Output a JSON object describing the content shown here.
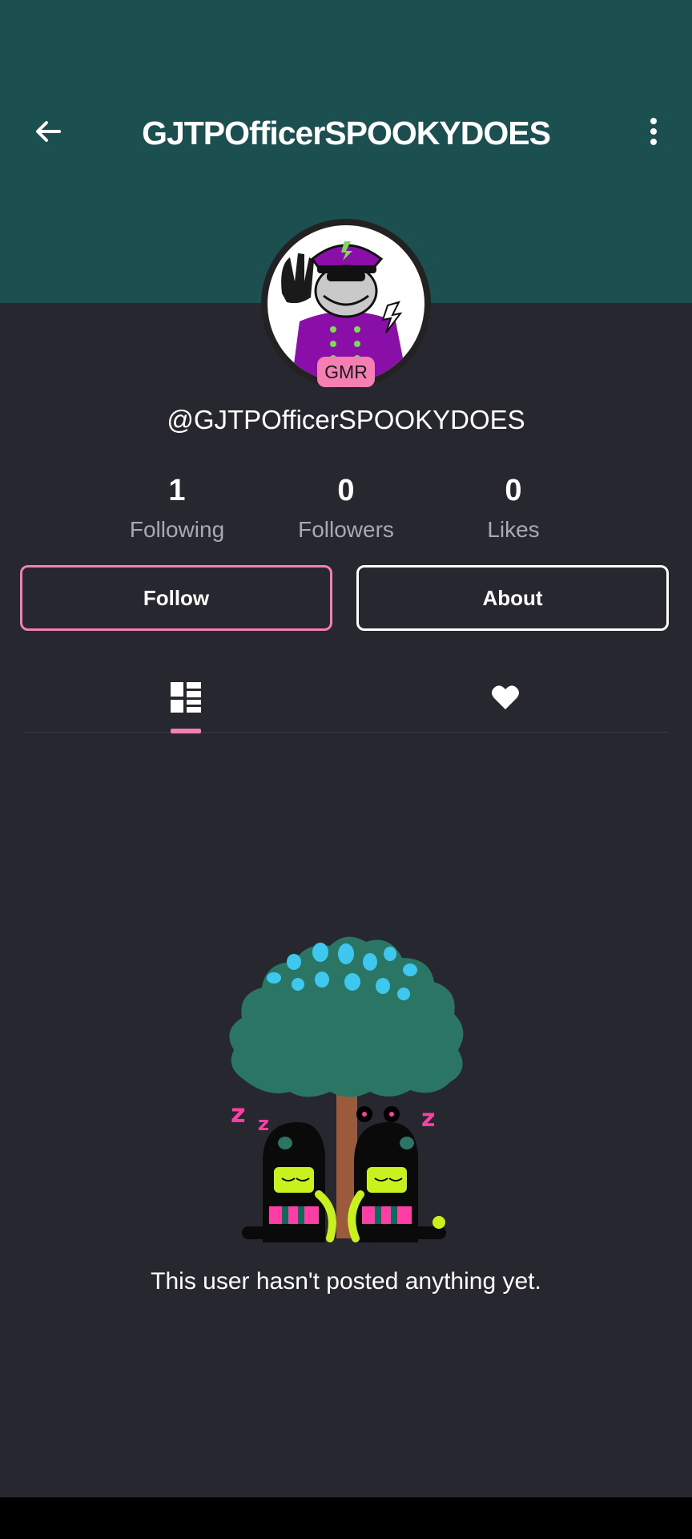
{
  "header": {
    "title": "GJTPOfficerSPOOKYDOES",
    "background_color": "#1c4f50",
    "back_icon": "arrow-left-icon",
    "menu_icon": "more-vertical-icon"
  },
  "profile": {
    "avatar_icon": "officer-avatar",
    "badge": "GMR",
    "username": "@GJTPOfficerSPOOKYDOES"
  },
  "stats": [
    {
      "value": "1",
      "label": "Following"
    },
    {
      "value": "0",
      "label": "Followers"
    },
    {
      "value": "0",
      "label": "Likes"
    }
  ],
  "actions": {
    "follow_label": "Follow",
    "about_label": "About"
  },
  "tabs": [
    {
      "icon": "grid-posts-icon",
      "active": true
    },
    {
      "icon": "heart-icon",
      "active": false
    }
  ],
  "empty_state": {
    "illustration": "sleeping-under-tree-illustration",
    "message": "This user hasn't posted anything yet."
  },
  "colors": {
    "accent": "#f47fb0",
    "background": "#27272f"
  }
}
